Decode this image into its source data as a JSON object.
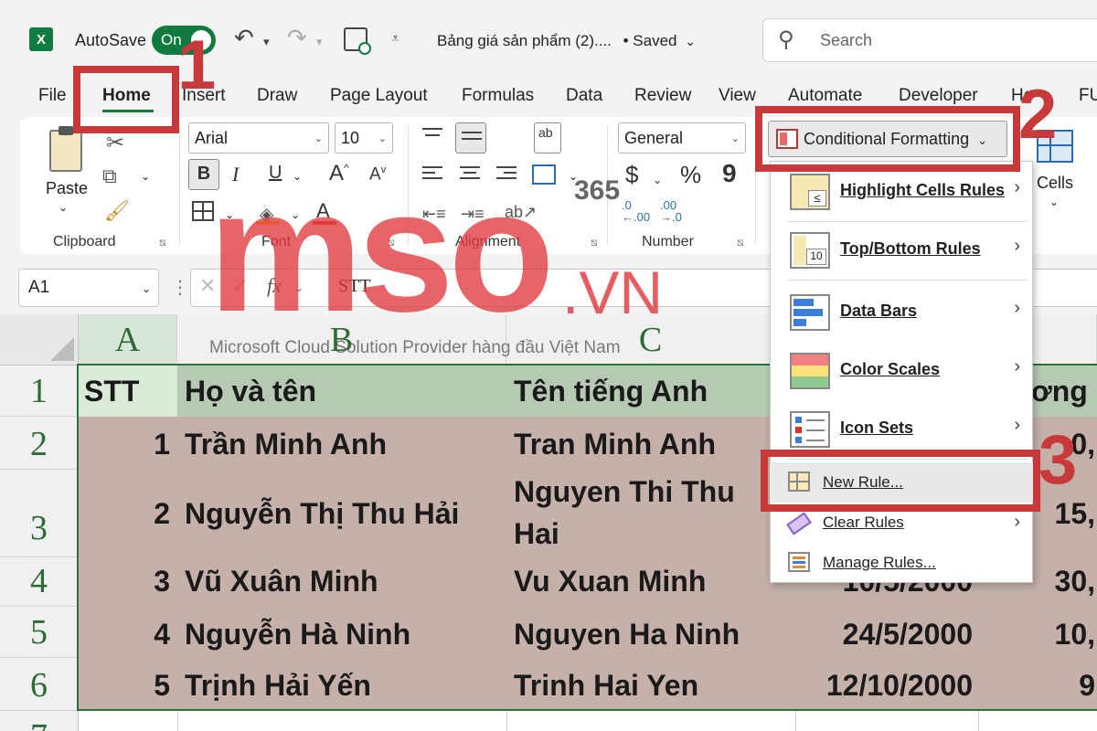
{
  "app": {
    "autosave_label": "AutoSave",
    "autosave_state": "On",
    "document_title": "Bảng giá sản phẩm (2)....",
    "saved_status": "• Saved",
    "search_placeholder": "Search",
    "icons": [
      "excel-logo-icon",
      "undo-icon",
      "redo-icon",
      "save-icon",
      "customize-icon",
      "search-icon"
    ]
  },
  "tabs": [
    "File",
    "Home",
    "Insert",
    "Draw",
    "Page Layout",
    "Formulas",
    "Data",
    "Review",
    "View",
    "Automate",
    "Developer",
    "He",
    "FU"
  ],
  "active_tab": "Home",
  "ribbon": {
    "clipboard": {
      "paste": "Paste",
      "label": "Clipboard"
    },
    "font": {
      "name": "Arial",
      "size": "10",
      "bold": "B",
      "italic": "I",
      "underline": "U",
      "grow": "A",
      "shrink": "A",
      "label": "Font"
    },
    "alignment": {
      "wrap": "ab",
      "label": "Alignment"
    },
    "number": {
      "format": "General",
      "currency": "$",
      "percent": "%",
      "comma": "9",
      "label": "Number"
    },
    "cells": {
      "label": "Cells"
    },
    "conditional_formatting": "Conditional Formatting"
  },
  "formula_bar": {
    "name_box": "A1",
    "fx": "fx",
    "content": "STT"
  },
  "columns": [
    "A",
    "B",
    "C"
  ],
  "rows": [
    "1",
    "2",
    "3",
    "4",
    "5",
    "6",
    "7"
  ],
  "table": {
    "header": [
      "STT",
      "Họ và tên",
      "Tên tiếng Anh",
      "ơng"
    ],
    "rows": [
      {
        "stt": "1",
        "name": "Trần Minh Anh",
        "en": "Tran Minh Anh",
        "date": "",
        "salary": "0,"
      },
      {
        "stt": "2",
        "name": "Nguyễn Thị Thu Hải",
        "en1": "Nguyen Thi Thu",
        "en2": "Hai",
        "date": "",
        "salary": "15,"
      },
      {
        "stt": "3",
        "name": "Vũ Xuân Minh",
        "en": "Vu Xuan Minh",
        "date": "10/5/2000",
        "salary": "30,"
      },
      {
        "stt": "4",
        "name": "Nguyễn Hà Ninh",
        "en": "Nguyen Ha Ninh",
        "date": "24/5/2000",
        "salary": "10,"
      },
      {
        "stt": "5",
        "name": "Trịnh Hải Yến",
        "en": "Trinh Hai Yen",
        "date": "12/10/2000",
        "salary": "9"
      }
    ]
  },
  "cf_menu": {
    "highlight": "Highlight Cells Rules",
    "topbottom": "Top/Bottom Rules",
    "databars": "Data Bars",
    "colorscales": "Color Scales",
    "iconsets": "Icon Sets",
    "newrule": "New Rule...",
    "clearrules": "Clear Rules",
    "managerules": "Manage Rules..."
  },
  "callouts": [
    "1",
    "2",
    "3"
  ],
  "watermark": {
    "brand": "mso",
    "vn": ".VN",
    "badge": "365",
    "tagline": "Microsoft Cloud Solution Provider hàng đầu Việt Nam"
  },
  "colors": {
    "excel_green": "#107c41",
    "header_fill": "#b5c9b3",
    "data_fill": "#c5b0aa",
    "annotation_red": "#c8393a",
    "watermark_red": "#e03a3e"
  }
}
